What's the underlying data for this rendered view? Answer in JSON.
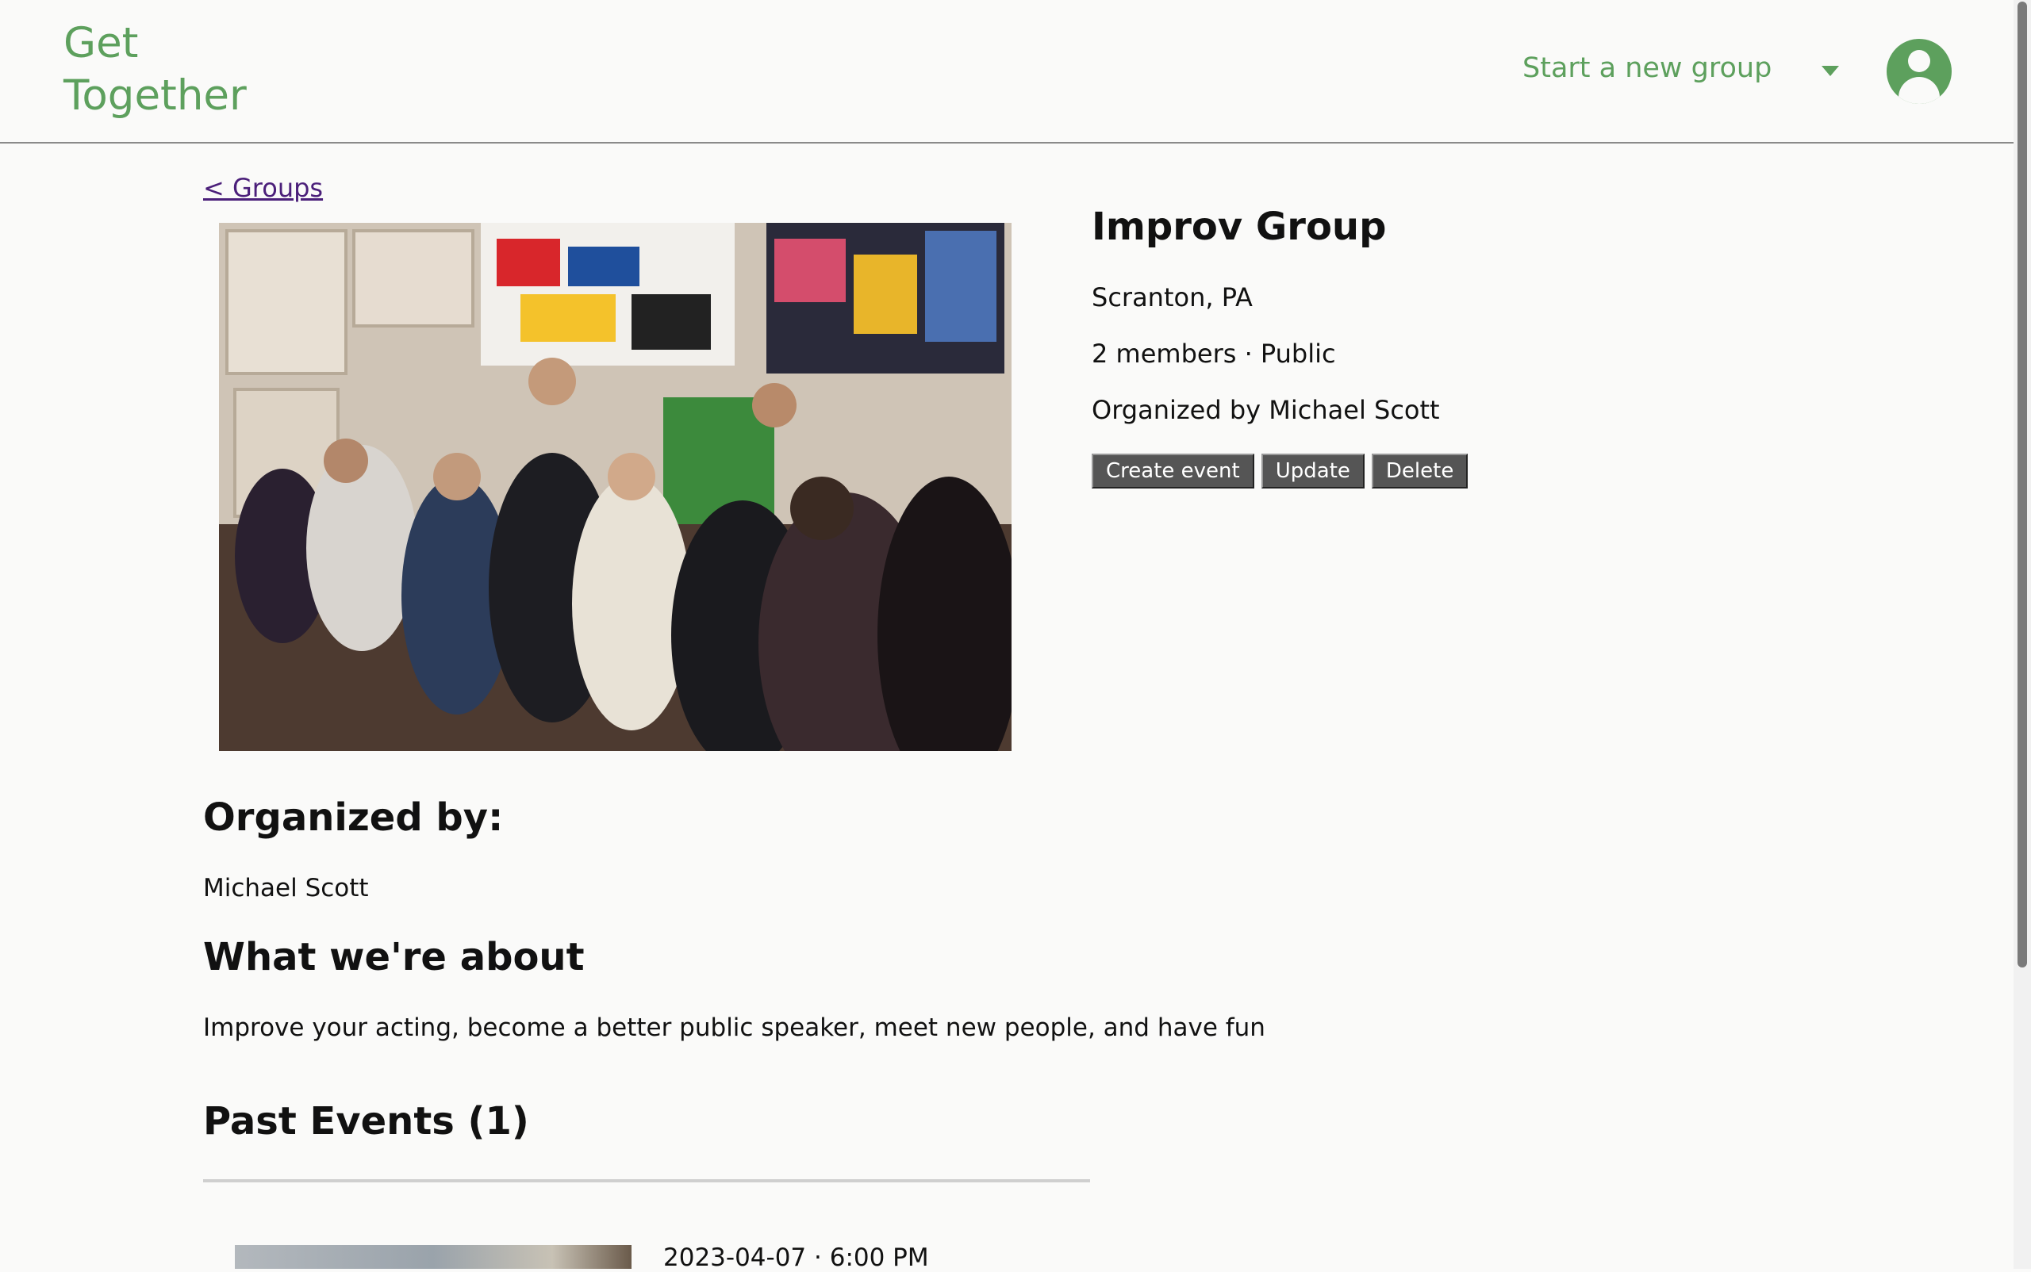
{
  "header": {
    "logo_line1": "Get",
    "logo_line2": "Together",
    "start_group_label": "Start a new group",
    "brand_color": "#5da05d"
  },
  "nav": {
    "back_label": "< Groups"
  },
  "group": {
    "title": "Improv Group",
    "location": "Scranton, PA",
    "members_line": "2 members · Public",
    "organized_line": "Organized by Michael Scott",
    "actions": {
      "create_event": "Create event",
      "update": "Update",
      "delete": "Delete"
    }
  },
  "sections": {
    "organized_heading": "Organized by:",
    "organizer_name": "Michael Scott",
    "about_heading": "What we're about",
    "about_text": "Improve your acting, become a better public speaker, meet new people, and have fun",
    "past_events_heading": "Past Events (1)"
  },
  "past_events": [
    {
      "datetime": "2023-04-07 · 6:00 PM"
    }
  ]
}
